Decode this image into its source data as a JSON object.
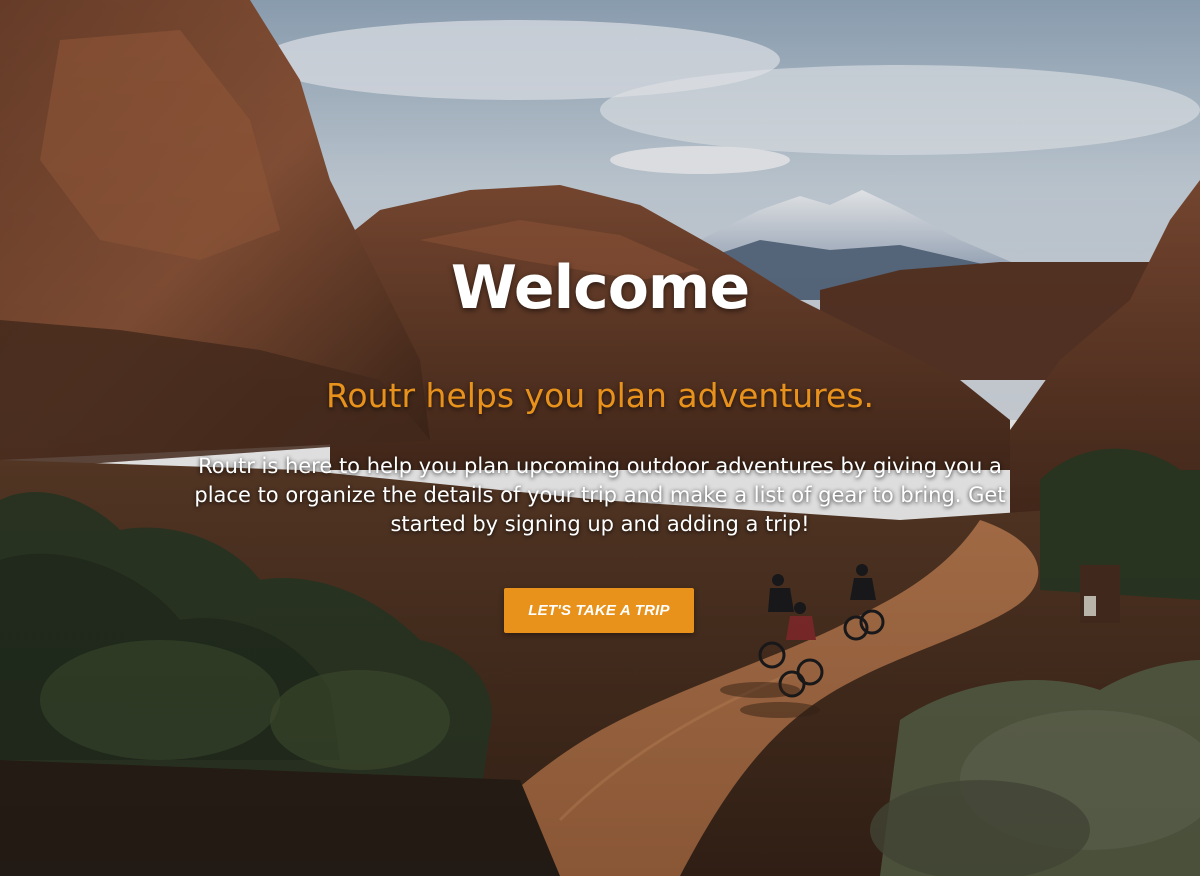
{
  "hero": {
    "image": "desert-canyon-bikepacking-photo",
    "title": "Welcome",
    "tagline": "Routr helps you plan adventures.",
    "intro": "Routr is here to help you plan upcoming outdoor adventures by giving you a place to organize the details of your trip and make a list of gear to bring. Get started by signing up and adding a trip!",
    "cta_label": "LET'S TAKE A TRIP"
  },
  "colors": {
    "accent": "#e8921c",
    "title_text": "#ffffff",
    "body_text": "#ffffff"
  }
}
